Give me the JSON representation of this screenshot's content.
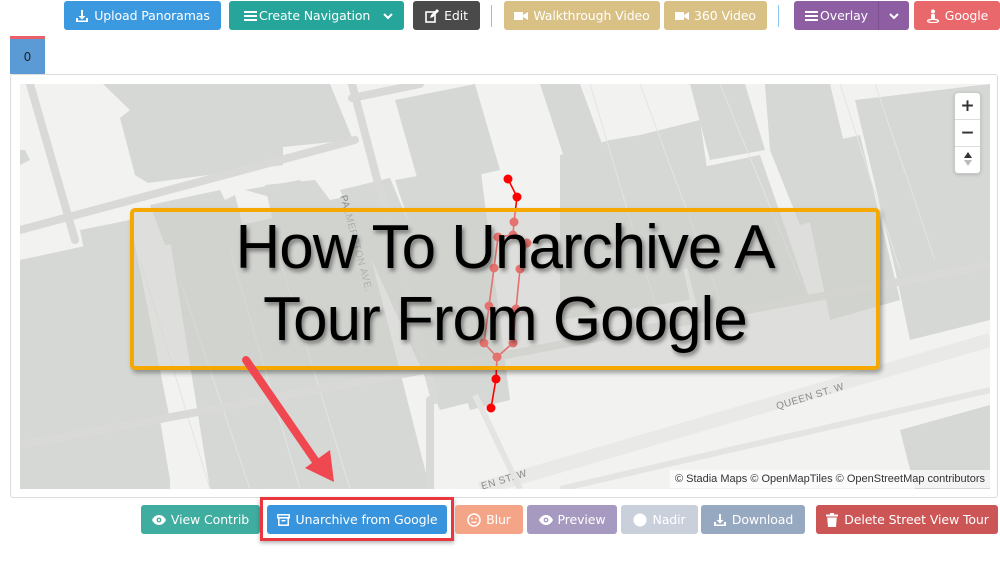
{
  "toolbar": {
    "upload_panoramas": "Upload Panoramas",
    "create_navigation": "Create Navigation",
    "edit": "Edit",
    "walkthrough_video": "Walkthrough Video",
    "video_360": "360 Video",
    "overlay": "Overlay",
    "google": "Google"
  },
  "tabs": [
    {
      "label": "0",
      "active": true
    }
  ],
  "map": {
    "zoom_in": "+",
    "zoom_out": "−",
    "compass": "▲",
    "attribution": "© Stadia Maps © OpenMapTiles © OpenStreetMap contributors",
    "streets": {
      "palmerston": "PALMERSTON AVE.",
      "queen_1": "QUEEN ST. W",
      "queen_2": "EN ST. W"
    },
    "path_color": "#ff0000"
  },
  "annotation": {
    "title_line1": "How To Unarchive A",
    "title_line2": "Tour From Google",
    "box_color": "#f5a800",
    "arrow_color": "#f04850"
  },
  "actions": {
    "view_contrib": "View Contrib",
    "unarchive": "Unarchive from Google",
    "blur": "Blur",
    "preview": "Preview",
    "nadir": "Nadir",
    "download": "Download",
    "delete": "Delete Street View Tour"
  },
  "colors": {
    "blue": "#3b99e0",
    "teal": "#26a69a",
    "dark": "#4a4a4a",
    "tan": "#d9c185",
    "purple": "#8e5ea2",
    "coral": "#e9686b",
    "salmon": "#f4a587",
    "lilac": "#a69ac0",
    "grey": "#c9d0db",
    "slate": "#97a9c0",
    "red": "#cc5556"
  }
}
